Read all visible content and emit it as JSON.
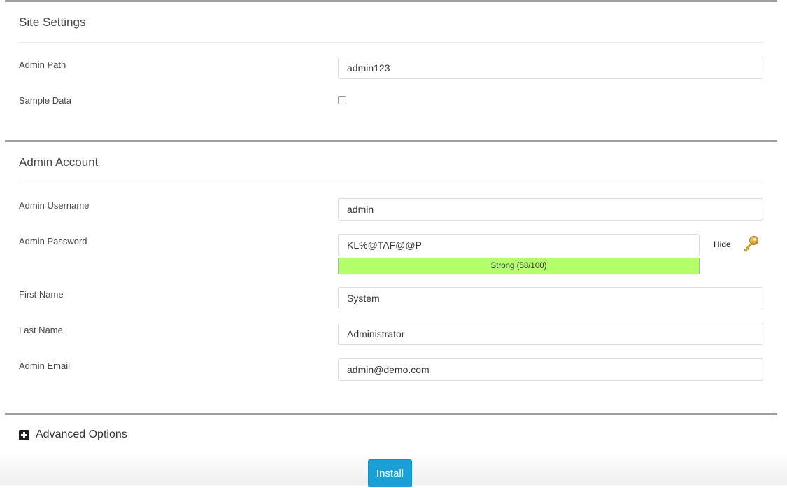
{
  "site_settings": {
    "title": "Site Settings",
    "admin_path_label": "Admin Path",
    "admin_path_value": "admin123",
    "sample_data_label": "Sample Data",
    "sample_data_checked": false
  },
  "admin_account": {
    "title": "Admin Account",
    "username_label": "Admin Username",
    "username_value": "admin",
    "password_label": "Admin Password",
    "password_value": "KL%@TAF@@P",
    "password_strength_text": "Strong (58/100)",
    "password_strength_score": 58,
    "strength_color": "#b2ff6b",
    "hide_label": "Hide",
    "key_icon": "key-icon",
    "first_name_label": "First Name",
    "first_name_value": "System",
    "last_name_label": "Last Name",
    "last_name_value": "Administrator",
    "email_label": "Admin Email",
    "email_value": "admin@demo.com"
  },
  "advanced": {
    "label": "Advanced Options",
    "icon": "plus-square-icon"
  },
  "actions": {
    "install_label": "Install",
    "install_color": "#1aa0d6"
  }
}
